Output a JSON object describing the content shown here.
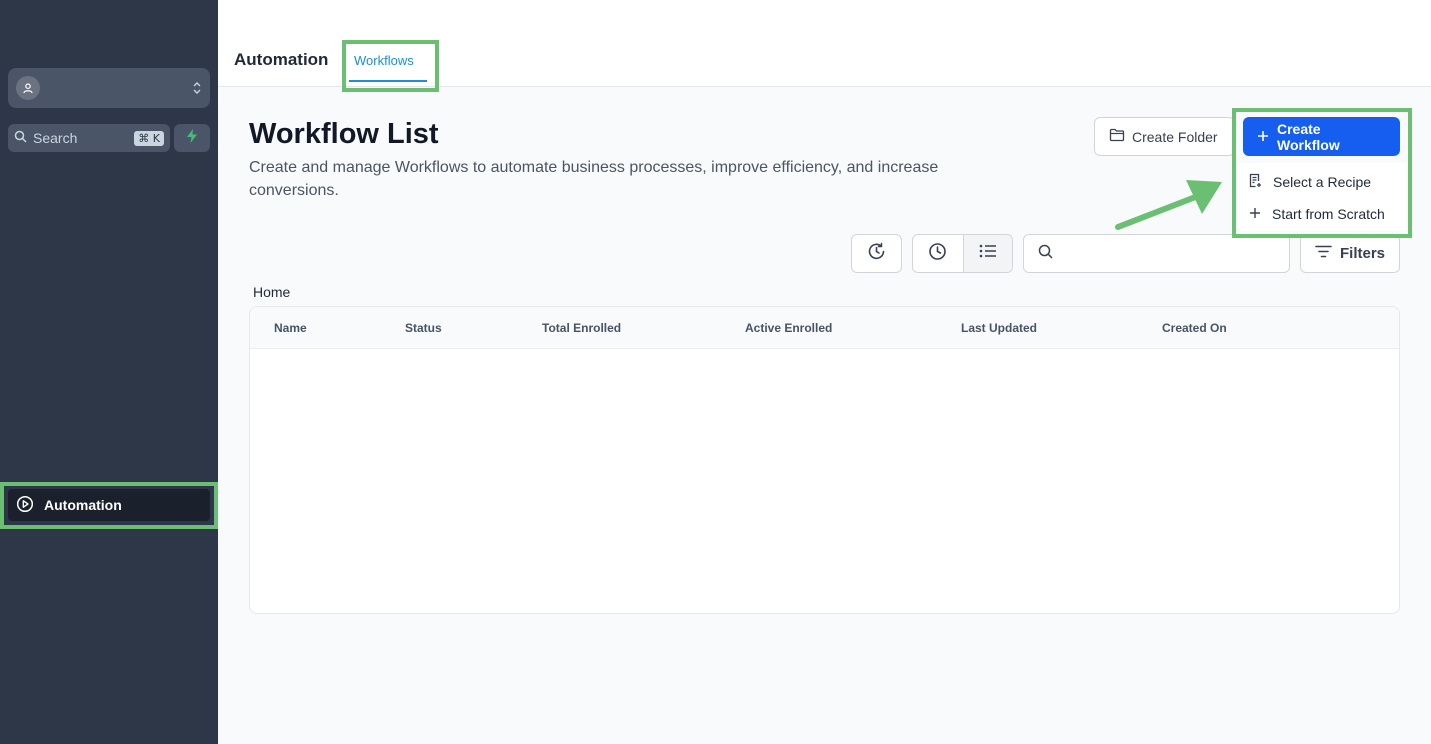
{
  "sidebar": {
    "search": {
      "placeholder": "Search",
      "shortcut": "⌘ K"
    },
    "nav_items": [
      {
        "label": "Automation",
        "icon": "play-circle-icon"
      }
    ]
  },
  "header": {
    "title": "Automation",
    "tabs": [
      {
        "label": "Workflows",
        "active": true
      }
    ]
  },
  "main": {
    "title": "Workflow List",
    "description": "Create and manage Workflows to automate business processes, improve efficiency, and increase conversions.",
    "create_folder_label": "Create Folder",
    "create_workflow_label": "Create Workflow",
    "create_menu": [
      {
        "label": "Select a Recipe",
        "icon": "recipe-icon"
      },
      {
        "label": "Start from Scratch",
        "icon": "plus-icon"
      }
    ],
    "filters_label": "Filters",
    "breadcrumb": "Home",
    "table": {
      "columns": [
        "Name",
        "Status",
        "Total Enrolled",
        "Active Enrolled",
        "Last Updated",
        "Created On"
      ],
      "rows": []
    }
  },
  "colors": {
    "sidebar_bg": "#2d3748",
    "primary": "#155eef",
    "tab_active": "#1d8fd1",
    "highlight": "#6abf73"
  }
}
